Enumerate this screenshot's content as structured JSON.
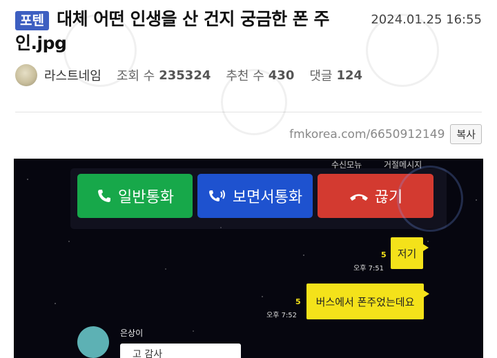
{
  "post": {
    "badge": "포텐",
    "title": "대체 어떤 인생을 산 건지 궁금한 폰 주인.jpg",
    "datetime": "2024.01.25 16:55",
    "author": "라스트네임",
    "stats": {
      "views_label": "조회 수",
      "views": "235324",
      "likes_label": "추천 수",
      "likes": "430",
      "comments_label": "댓글",
      "comments": "124"
    },
    "url": "fmkorea.com/6650912149",
    "copy_label": "복사"
  },
  "phone_screen": {
    "top_labels": [
      "수신모뉴",
      "거절메시지"
    ],
    "buttons": {
      "normal_call": "일반통화",
      "video_call": "보면서통화",
      "hang_up": "끊기"
    },
    "colors": {
      "normal": "#17a84a",
      "video": "#1e52cf",
      "hang": "#d33a30",
      "bubble": "#f4e21a"
    },
    "messages": [
      {
        "text": "저기",
        "unread": "5",
        "time": "오후 7:51"
      },
      {
        "text": "버스에서 폰주었는데요",
        "unread": "5",
        "time": "오후 7:52"
      }
    ],
    "friend": {
      "name": "은상이",
      "message": "고 감사"
    }
  }
}
